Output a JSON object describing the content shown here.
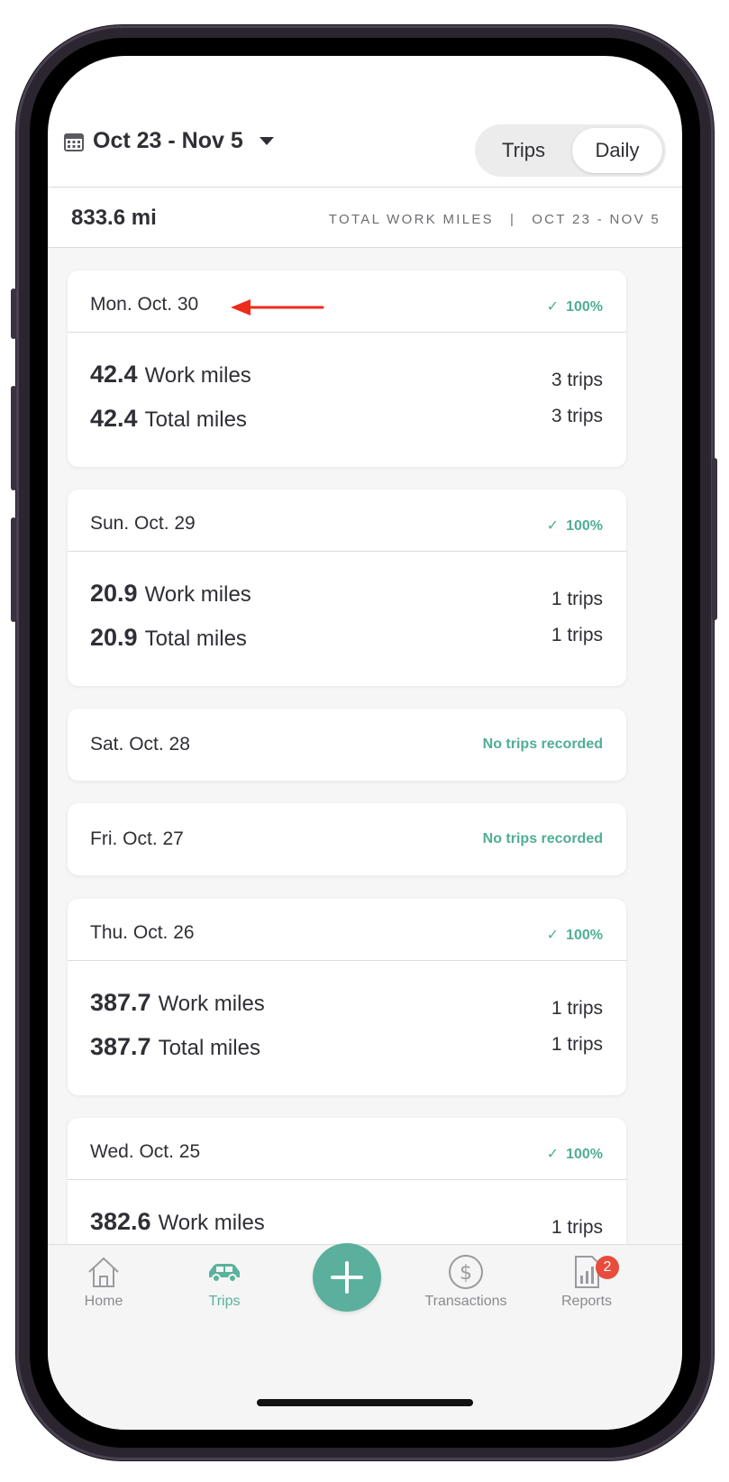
{
  "header": {
    "date_range": "Oct 23 - Nov 5",
    "segments": [
      "Trips",
      "Daily"
    ],
    "active_segment": "Daily"
  },
  "summary": {
    "total_miles": "833.6 mi",
    "label": "TOTAL WORK MILES",
    "separator": "|",
    "range": "OCT 23 - NOV 5"
  },
  "days": [
    {
      "day": "Mon. Oct. 30",
      "status": "100%",
      "work_miles": "42.4",
      "work_label": "Work miles",
      "work_trips": "3 trips",
      "total_miles": "42.4",
      "total_label": "Total miles",
      "total_trips": "3 trips"
    },
    {
      "day": "Sun. Oct. 29",
      "status": "100%",
      "work_miles": "20.9",
      "work_label": "Work miles",
      "work_trips": "1 trips",
      "total_miles": "20.9",
      "total_label": "Total miles",
      "total_trips": "1 trips"
    },
    {
      "day": "Sat. Oct. 28",
      "status": "No trips recorded"
    },
    {
      "day": "Fri. Oct. 27",
      "status": "No trips recorded"
    },
    {
      "day": "Thu. Oct. 26",
      "status": "100%",
      "work_miles": "387.7",
      "work_label": "Work miles",
      "work_trips": "1 trips",
      "total_miles": "387.7",
      "total_label": "Total miles",
      "total_trips": "1 trips"
    },
    {
      "day": "Wed. Oct. 25",
      "status": "100%",
      "work_miles": "382.6",
      "work_label": "Work miles",
      "work_trips": "1 trips"
    }
  ],
  "tabs": {
    "home": "Home",
    "trips": "Trips",
    "transactions": "Transactions",
    "reports": "Reports",
    "reports_badge": "2",
    "active": "Trips"
  },
  "colors": {
    "accent": "#5ab09c",
    "badge": "#e74c3c",
    "annotation_arrow": "#ee2b1b"
  }
}
